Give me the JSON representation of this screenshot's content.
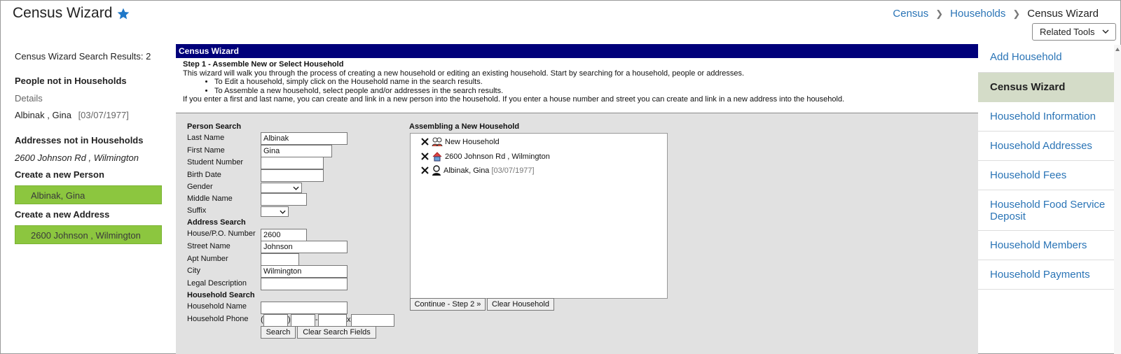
{
  "header": {
    "title": "Census Wizard",
    "breadcrumb": [
      "Census",
      "Households",
      "Census Wizard"
    ],
    "related_tools": "Related Tools"
  },
  "results": {
    "count_label": "Census Wizard Search Results: 2",
    "people_heading": "People not in Households",
    "details_label": "Details",
    "person_name": "Albinak , Gina",
    "person_date": "[03/07/1977]",
    "addresses_heading": "Addresses not in Households",
    "address": "2600 Johnson Rd , Wilmington",
    "create_person_heading": "Create a new Person",
    "create_person_button": "Albinak, Gina",
    "create_address_heading": "Create a new Address",
    "create_address_button": "2600 Johnson , Wilmington"
  },
  "wizard": {
    "title": "Census Wizard",
    "step_title": "Step 1 - Assemble New or Select Household",
    "intro": "This wizard will walk you through the process of creating a new household or editing an existing household. Start by searching for a household, people or addresses.",
    "bullets": [
      "To Edit a household, simply click on the Household name in the search results.",
      "To Assemble a new household, select people and/or addresses in the search results."
    ],
    "note": "If you enter a first and last name, you can create and link in a new person into the household. If you enter a house number and street you can create and link in a new address into the household."
  },
  "person_search": {
    "heading": "Person Search",
    "last_name_label": "Last Name",
    "last_name": "Albinak",
    "first_name_label": "First Name",
    "first_name": "Gina",
    "student_number_label": "Student Number",
    "student_number": "",
    "birth_date_label": "Birth Date",
    "birth_date": "",
    "gender_label": "Gender",
    "middle_name_label": "Middle Name",
    "middle_name": "",
    "suffix_label": "Suffix"
  },
  "address_search": {
    "heading": "Address Search",
    "house_number_label": "House/P.O. Number",
    "house_number": "2600",
    "street_label": "Street Name",
    "street": "Johnson",
    "apt_label": "Apt Number",
    "apt": "",
    "city_label": "City",
    "city": "Wilmington",
    "legal_label": "Legal Description",
    "legal": ""
  },
  "household_search": {
    "heading": "Household Search",
    "name_label": "Household Name",
    "name": "",
    "phone_label": "Household Phone",
    "phone_open": "(",
    "phone_close": ")",
    "phone_dash": "-",
    "phone_ext": "x",
    "search_button": "Search",
    "clear_button": "Clear Search Fields"
  },
  "assembling": {
    "heading": "Assembling a New Household",
    "items": [
      {
        "label": "New Household",
        "date": "",
        "icon": "household-icon"
      },
      {
        "label": "2600 Johnson Rd , Wilmington",
        "date": "",
        "icon": "house-icon"
      },
      {
        "label": "Albinak, Gina",
        "date": "[03/07/1977]",
        "icon": "person-icon"
      }
    ],
    "continue_button": "Continue - Step 2 »",
    "clear_button": "Clear Household"
  },
  "right_nav": {
    "items": [
      "Add Household",
      "Census Wizard",
      "Household Information",
      "Household Addresses",
      "Household Fees",
      "Household Food Service Deposit",
      "Household Members",
      "Household Payments"
    ],
    "active_index": 1
  },
  "colors": {
    "link": "#2a74b6",
    "titlebar": "#00007a",
    "green_button": "#8cc63f",
    "active_nav": "#d4dcc8",
    "form_bg": "#e1e1e1"
  }
}
